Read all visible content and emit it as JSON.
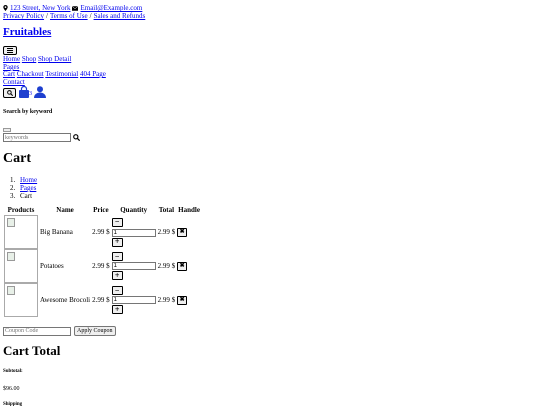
{
  "topbar": {
    "address": "123 Street, New York",
    "email": "Email@Example.com",
    "links": [
      "Privacy Policy",
      "Terms of Use",
      "Sales and Refunds"
    ]
  },
  "brand": "Fruitables",
  "nav": {
    "items_row1": [
      "Home",
      "Shop",
      "Shop Detail"
    ],
    "pages": "Pages",
    "items_row3": [
      "Cart",
      "Chackout",
      "Testimonial",
      "404 Page"
    ],
    "contact": "Contact"
  },
  "cart_badge": "3",
  "search": {
    "title": "Search by keyword",
    "placeholder": "keywords"
  },
  "page_title": "Cart",
  "breadcrumb": [
    "Home",
    "Pages",
    "Cart"
  ],
  "table": {
    "headers": [
      "Products",
      "Name",
      "Price",
      "Quantity",
      "Total",
      "Handle"
    ],
    "rows": [
      {
        "name": "Big Banana",
        "price": "2.99 $",
        "qty": "1",
        "total": "2.99 $"
      },
      {
        "name": "Potatoes",
        "price": "2.99 $",
        "qty": "1",
        "total": "2.99 $"
      },
      {
        "name": "Awesome Brocoli",
        "price": "2.99 $",
        "qty": "1",
        "total": "2.99 $"
      }
    ]
  },
  "coupon": {
    "placeholder": "Coupon Code",
    "button": "Apply Coupon"
  },
  "cart_total": {
    "title": "Cart Total",
    "subtotal_label": "Subtotal:",
    "subtotal_value": "$96.00",
    "shipping_label": "Shipping"
  }
}
